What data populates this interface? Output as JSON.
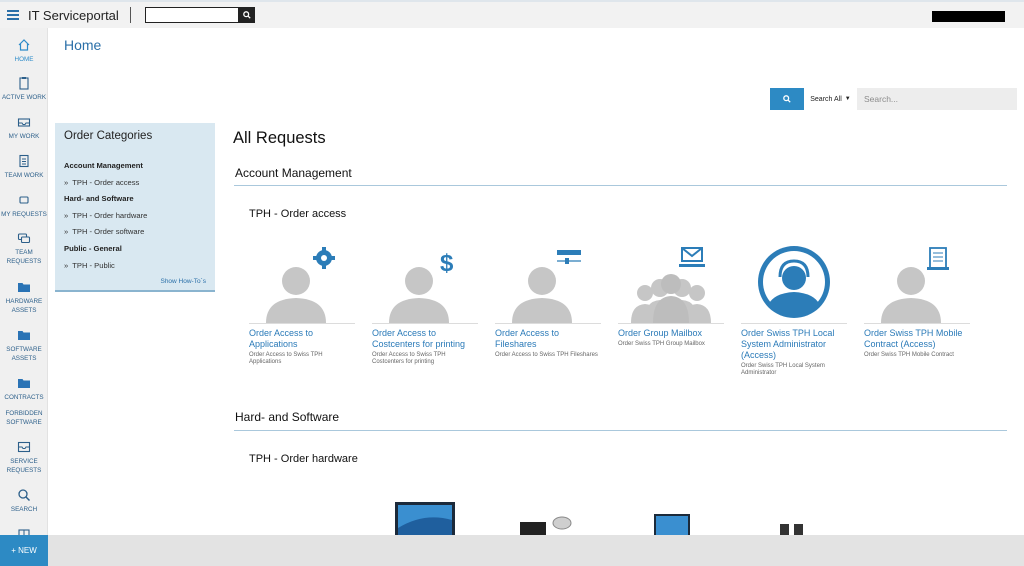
{
  "app": {
    "title": "IT Serviceportal"
  },
  "nav": {
    "items": [
      {
        "label": "HOME",
        "icon": "home-icon"
      },
      {
        "label": "ACTIVE WORK",
        "icon": "clipboard-icon"
      },
      {
        "label": "MY WORK",
        "icon": "inbox-icon"
      },
      {
        "label": "TEAM WORK",
        "icon": "list-icon"
      },
      {
        "label": "MY REQUESTS",
        "icon": "chat-icon"
      },
      {
        "label": "TEAM\nREQUESTS",
        "icon": "chats-icon"
      },
      {
        "label": "HARDWARE\nASSETS",
        "icon": "folder-icon"
      },
      {
        "label": "SOFTWARE\nASSETS",
        "icon": "folder-icon"
      },
      {
        "label": "CONTRACTS",
        "icon": "folder-icon"
      },
      {
        "label": "FORBIDDEN\nSOFTWARE",
        "icon": ""
      },
      {
        "label": "SERVICE\nREQUESTS",
        "icon": "tray-icon"
      },
      {
        "label": "SEARCH",
        "icon": "search-icon"
      }
    ],
    "new_label": "+ NEW"
  },
  "main": {
    "title": "Home",
    "search": {
      "scope": "Search All",
      "placeholder": "Search..."
    }
  },
  "categories": {
    "title": "Order Categories",
    "groups": [
      {
        "name": "Account Management",
        "links": [
          "TPH - Order access"
        ]
      },
      {
        "name": "Hard- and Software",
        "links": [
          "TPH - Order hardware",
          "TPH - Order software"
        ]
      },
      {
        "name": "Public - General",
        "links": [
          "TPH - Public"
        ]
      }
    ],
    "show_howtos": "Show How-To´s"
  },
  "requests": {
    "title": "All Requests",
    "sections": [
      {
        "title": "Account Management",
        "subsection": "TPH - Order access",
        "tiles": [
          {
            "name": "Order Access to Applications",
            "desc": "Order Access to Swiss TPH Applications",
            "badge": "gear-icon"
          },
          {
            "name": "Order Access to Costcenters for printing",
            "desc": "Order Access to Swiss TPH Costcenters for printing",
            "badge": "dollar-icon"
          },
          {
            "name": "Order Access to Fileshares",
            "desc": "Order Access to Swiss TPH Fileshares",
            "badge": "server-icon"
          },
          {
            "name": "Order Group Mailbox",
            "desc": "Order Swiss TPH Group Mailbox",
            "badge": "envelope-icon"
          },
          {
            "name": "Order Swiss TPH Local System Administrator (Access)",
            "desc": "Order Swiss TPH Local System Administrator",
            "badge": "support-agent-icon"
          },
          {
            "name": "Order Swiss TPH Mobile Contract (Access)",
            "desc": "Order Swiss TPH Mobile Contract",
            "badge": "contract-icon"
          }
        ]
      },
      {
        "title": "Hard- and Software",
        "subsection": "TPH - Order hardware"
      }
    ]
  },
  "colors": {
    "accent": "#2d8ac4",
    "link": "#2a7ab8",
    "panel": "#d9e8f1"
  }
}
